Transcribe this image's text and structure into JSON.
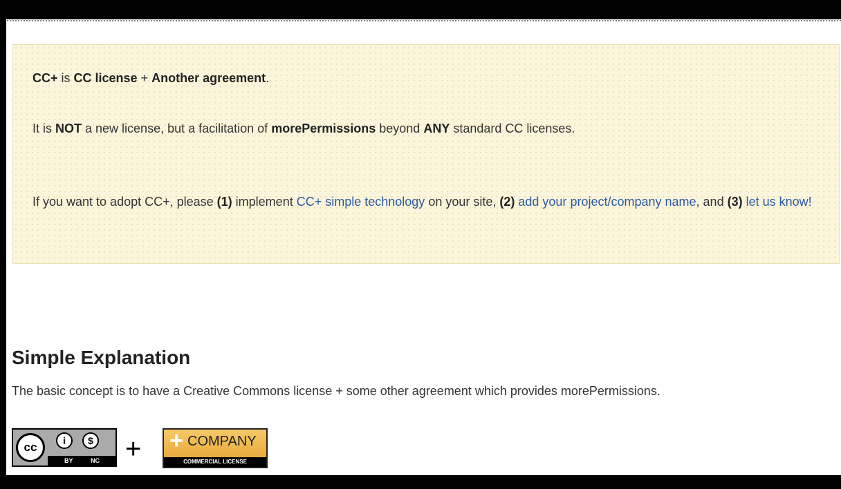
{
  "notice": {
    "p1": {
      "s1": "CC+",
      "s2": " is ",
      "s3": "CC license",
      "s4": " + ",
      "s5": "Another agreement",
      "s6": "."
    },
    "p2": {
      "s1": "It is ",
      "s2": "NOT",
      "s3": " a new license, but a facilitation of ",
      "s4": "morePermissions",
      "s5": " beyond ",
      "s6": "ANY",
      "s7": " standard CC licenses."
    },
    "p3": {
      "s1": "If you want to adopt CC+, please ",
      "s2": "(1)",
      "s3": " implement ",
      "link1": "CC+ simple technology",
      "s4": " on your site, ",
      "s5": "(2)",
      "s6": " ",
      "link2": "add your project/company name",
      "s7": ", and ",
      "s8": "(3)",
      "s9": " ",
      "link3": "let us know!"
    }
  },
  "section": {
    "title": "Simple Explanation",
    "description": "The basic concept is to have a Creative Commons license + some other agreement which provides morePermissions."
  },
  "cc_badge": {
    "circle": "cc",
    "by": "BY",
    "nc": "NC",
    "by_symbol": "i",
    "nc_symbol": "$"
  },
  "plus": "+",
  "company_badge": {
    "plus": "+",
    "name": "COMPANY",
    "subtitle": "COMMERCIAL LICENSE"
  },
  "colors": {
    "link": "#2b5aa0",
    "notice_bg": "#fbf5dc",
    "frame": "#000000"
  }
}
